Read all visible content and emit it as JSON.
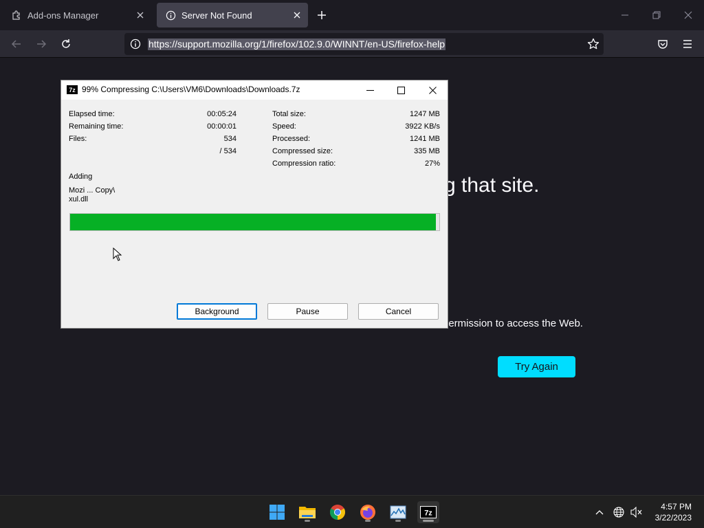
{
  "browser": {
    "tabs": [
      {
        "label": "Add-ons Manager",
        "icon": "puzzle-icon",
        "active": false
      },
      {
        "label": "Server Not Found",
        "icon": "info-icon",
        "active": true
      }
    ],
    "url": "https://support.mozilla.org/1/firefox/102.9.0/WINNT/en-US/firefox-help"
  },
  "page": {
    "title_tail": "g that site.",
    "text_tail": "permission to access the Web.",
    "try_again_label": "Try Again",
    "accent": "#00ddff"
  },
  "dialog": {
    "title": "99% Compressing C:\\Users\\VM6\\Downloads\\Downloads.7z",
    "app_icon_text": "7z",
    "left_stats": [
      {
        "label": "Elapsed time:",
        "value": "00:05:24"
      },
      {
        "label": "Remaining time:",
        "value": "00:00:01"
      },
      {
        "label": "Files:",
        "value": "534"
      },
      {
        "label": "",
        "value": "/ 534"
      }
    ],
    "right_stats": [
      {
        "label": "Total size:",
        "value": "1247 MB"
      },
      {
        "label": "Speed:",
        "value": "3922 KB/s"
      },
      {
        "label": "Processed:",
        "value": "1241 MB"
      },
      {
        "label": "Compressed size:",
        "value": "335 MB"
      },
      {
        "label": "Compression ratio:",
        "value": "27%"
      }
    ],
    "status": "Adding",
    "current_file_line1": "Mozi ... Copy\\",
    "current_file_line2": "xul.dll",
    "progress_percent": 99,
    "progress_color": "#06b025",
    "buttons": {
      "background": "Background",
      "pause": "Pause",
      "cancel": "Cancel"
    }
  },
  "taskbar": {
    "time": "4:57 PM",
    "date": "3/22/2023"
  }
}
